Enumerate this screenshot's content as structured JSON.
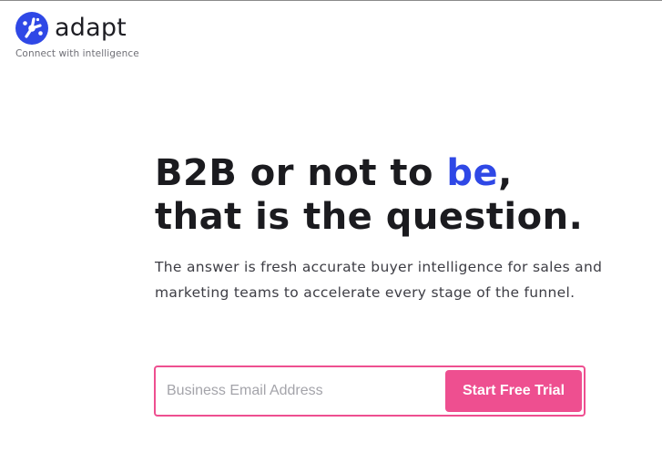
{
  "brand": {
    "name": "adapt",
    "tagline": "Connect with intelligence",
    "logo_icon": "adapt-logo-icon",
    "logo_color": "#2f48e6"
  },
  "hero": {
    "headline_part1": "B2B or not to ",
    "headline_accent": "be",
    "headline_part2": ",",
    "headline_line2": "that is the question.",
    "subtext": "The answer is fresh accurate buyer intelligence for sales and marketing teams to accelerate every stage of the funnel.",
    "accent_color": "#2f48e6"
  },
  "signup": {
    "email_placeholder": "Business Email Address",
    "email_value": "",
    "cta_label": "Start Free Trial",
    "cta_color": "#ee4f90"
  }
}
